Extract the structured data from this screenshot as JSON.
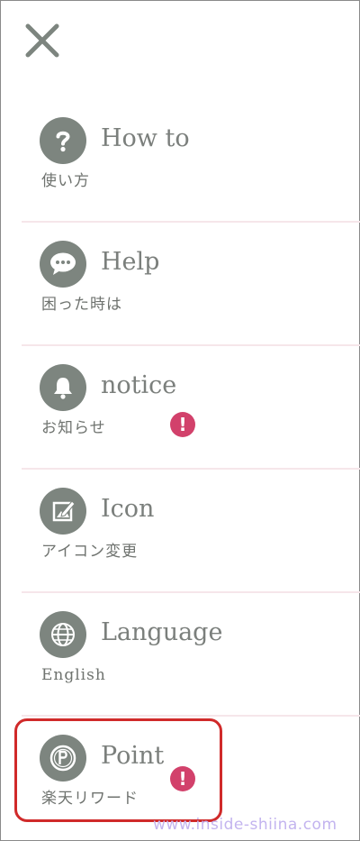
{
  "close": {
    "icon": "close-icon"
  },
  "menu": {
    "items": [
      {
        "id": "how-to",
        "icon": "question-icon",
        "title": "How to",
        "subtitle": "使い方",
        "has_alert": false
      },
      {
        "id": "help",
        "icon": "chat-bubble-icon",
        "title": "Help",
        "subtitle": "困った時は",
        "has_alert": false
      },
      {
        "id": "notice",
        "icon": "bell-icon",
        "title": "notice",
        "subtitle": "お知らせ",
        "has_alert": true,
        "alert_symbol": "!"
      },
      {
        "id": "icon",
        "icon": "edit-image-icon",
        "title": "Icon",
        "subtitle": "アイコン変更",
        "has_alert": false
      },
      {
        "id": "language",
        "icon": "globe-icon",
        "title": "Language",
        "subtitle": "English",
        "has_alert": false
      },
      {
        "id": "point",
        "icon": "point-coin-icon",
        "title": "Point",
        "subtitle": "楽天リワード",
        "has_alert": true,
        "alert_symbol": "!"
      }
    ]
  },
  "watermark": "www.inside-shiina.com",
  "colors": {
    "icon_bg": "#7d857f",
    "text": "#7b7f7c",
    "alert": "#d2416b",
    "divider": "#f6e6ea",
    "highlight": "#d02a2a",
    "watermark": "#c3b4ef"
  }
}
